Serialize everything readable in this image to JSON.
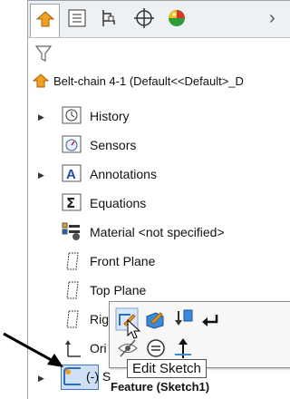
{
  "feature_tree": {
    "root_label": "Belt-chain 4-1  (Default<<Default>_D",
    "items": [
      {
        "label": "History"
      },
      {
        "label": "Sensors"
      },
      {
        "label": "Annotations"
      },
      {
        "label": "Equations"
      },
      {
        "label": "Material <not specified>"
      },
      {
        "label": "Front Plane"
      },
      {
        "label": "Top Plane"
      },
      {
        "label": "Rig"
      },
      {
        "label": "Ori"
      },
      {
        "label": "(-) S"
      }
    ]
  },
  "context_popup": {
    "tooltip": "Edit Sketch",
    "feature_label": "Feature (Sketch1)"
  },
  "tabs": [
    "feature-manager",
    "property-manager",
    "configuration-manager",
    "dimxpert-manager",
    "display-manager"
  ],
  "colors": {
    "accent": "#f0a020",
    "selection": "#3c78c8"
  }
}
